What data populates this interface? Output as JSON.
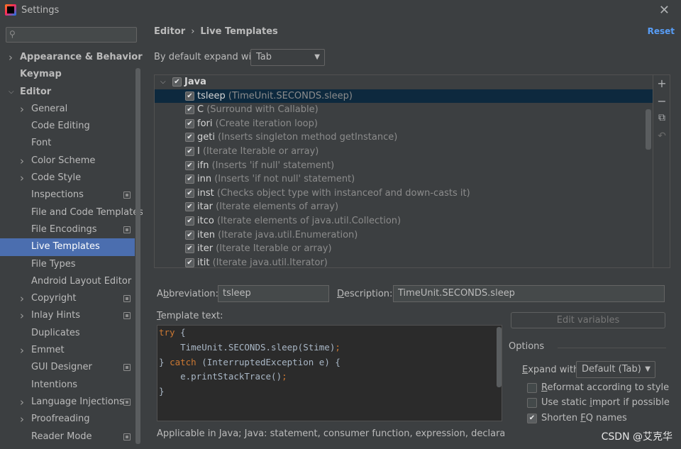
{
  "window": {
    "title": "Settings"
  },
  "search": {
    "placeholder": "",
    "value": ""
  },
  "sidebar": {
    "items": [
      {
        "label": "Appearance & Behavior",
        "level": 0,
        "arrow": "right",
        "bold": true,
        "project": false,
        "selected": false
      },
      {
        "label": "Keymap",
        "level": 0,
        "arrow": "",
        "bold": true,
        "project": false,
        "selected": false
      },
      {
        "label": "Editor",
        "level": 0,
        "arrow": "down",
        "bold": true,
        "project": false,
        "selected": false
      },
      {
        "label": "General",
        "level": 1,
        "arrow": "right",
        "bold": false,
        "project": false,
        "selected": false
      },
      {
        "label": "Code Editing",
        "level": 1,
        "arrow": "",
        "bold": false,
        "project": false,
        "selected": false
      },
      {
        "label": "Font",
        "level": 1,
        "arrow": "",
        "bold": false,
        "project": false,
        "selected": false
      },
      {
        "label": "Color Scheme",
        "level": 1,
        "arrow": "right",
        "bold": false,
        "project": false,
        "selected": false
      },
      {
        "label": "Code Style",
        "level": 1,
        "arrow": "right",
        "bold": false,
        "project": false,
        "selected": false
      },
      {
        "label": "Inspections",
        "level": 1,
        "arrow": "",
        "bold": false,
        "project": true,
        "selected": false
      },
      {
        "label": "File and Code Templates",
        "level": 1,
        "arrow": "",
        "bold": false,
        "project": false,
        "selected": false
      },
      {
        "label": "File Encodings",
        "level": 1,
        "arrow": "",
        "bold": false,
        "project": true,
        "selected": false
      },
      {
        "label": "Live Templates",
        "level": 1,
        "arrow": "",
        "bold": false,
        "project": false,
        "selected": true
      },
      {
        "label": "File Types",
        "level": 1,
        "arrow": "",
        "bold": false,
        "project": false,
        "selected": false
      },
      {
        "label": "Android Layout Editor",
        "level": 1,
        "arrow": "",
        "bold": false,
        "project": false,
        "selected": false
      },
      {
        "label": "Copyright",
        "level": 1,
        "arrow": "right",
        "bold": false,
        "project": true,
        "selected": false
      },
      {
        "label": "Inlay Hints",
        "level": 1,
        "arrow": "right",
        "bold": false,
        "project": true,
        "selected": false
      },
      {
        "label": "Duplicates",
        "level": 1,
        "arrow": "",
        "bold": false,
        "project": false,
        "selected": false
      },
      {
        "label": "Emmet",
        "level": 1,
        "arrow": "right",
        "bold": false,
        "project": false,
        "selected": false
      },
      {
        "label": "GUI Designer",
        "level": 1,
        "arrow": "",
        "bold": false,
        "project": true,
        "selected": false
      },
      {
        "label": "Intentions",
        "level": 1,
        "arrow": "",
        "bold": false,
        "project": false,
        "selected": false
      },
      {
        "label": "Language Injections",
        "level": 1,
        "arrow": "right",
        "bold": false,
        "project": true,
        "selected": false
      },
      {
        "label": "Proofreading",
        "level": 1,
        "arrow": "right",
        "bold": false,
        "project": false,
        "selected": false
      },
      {
        "label": "Reader Mode",
        "level": 1,
        "arrow": "",
        "bold": false,
        "project": true,
        "selected": false
      }
    ]
  },
  "header": {
    "crumb_parent": "Editor",
    "crumb_sep": "›",
    "crumb_current": "Live Templates",
    "reset": "Reset"
  },
  "expand": {
    "label": "By default expand with",
    "value": "Tab"
  },
  "templates": {
    "group": "Java",
    "items": [
      {
        "abbr": "tsleep",
        "desc": "(TimeUnit.SECONDS.sleep)",
        "checked": true,
        "selected": true
      },
      {
        "abbr": "C",
        "desc": "(Surround with Callable)",
        "checked": true,
        "selected": false
      },
      {
        "abbr": "fori",
        "desc": "(Create iteration loop)",
        "checked": true,
        "selected": false
      },
      {
        "abbr": "geti",
        "desc": "(Inserts singleton method getInstance)",
        "checked": true,
        "selected": false
      },
      {
        "abbr": "I",
        "desc": "(Iterate Iterable or array)",
        "checked": true,
        "selected": false
      },
      {
        "abbr": "ifn",
        "desc": "(Inserts 'if null' statement)",
        "checked": true,
        "selected": false
      },
      {
        "abbr": "inn",
        "desc": "(Inserts 'if not null' statement)",
        "checked": true,
        "selected": false
      },
      {
        "abbr": "inst",
        "desc": "(Checks object type with instanceof and down-casts it)",
        "checked": true,
        "selected": false
      },
      {
        "abbr": "itar",
        "desc": "(Iterate elements of array)",
        "checked": true,
        "selected": false
      },
      {
        "abbr": "itco",
        "desc": "(Iterate elements of java.util.Collection)",
        "checked": true,
        "selected": false
      },
      {
        "abbr": "iten",
        "desc": "(Iterate java.util.Enumeration)",
        "checked": true,
        "selected": false
      },
      {
        "abbr": "iter",
        "desc": "(Iterate Iterable or array)",
        "checked": true,
        "selected": false
      },
      {
        "abbr": "itit",
        "desc": "(Iterate java.util.Iterator)",
        "checked": true,
        "selected": false
      }
    ]
  },
  "tools": {
    "add": "+",
    "remove": "−",
    "copy": "⧉",
    "revert": "↶"
  },
  "details": {
    "abbr_label_pre": "A",
    "abbr_label_u": "b",
    "abbr_label_post": "breviation:",
    "abbr_value": "tsleep",
    "desc_label_u": "D",
    "desc_label_post": "escription:",
    "desc_value": "TimeUnit.SECONDS.sleep",
    "template_label_u": "T",
    "template_label_post": "emplate text:"
  },
  "code": {
    "line1_kw": "try",
    "line1_rest": " {",
    "line2": "    TimeUnit.SECONDS.sleep(Stime)",
    "line2_semi": ";",
    "line3_a": "} ",
    "line3_kw": "catch",
    "line3_rest": " (InterruptedException e) {",
    "line4": "    e.printStackTrace()",
    "line4_semi": ";",
    "line5": "}"
  },
  "options": {
    "edit_variables": "Edit variables",
    "title": "Options",
    "expand_label_u": "E",
    "expand_label_post": "xpand with",
    "expand_value": "Default (Tab)",
    "reformat_u": "R",
    "reformat_post": "eformat according to style",
    "reformat_checked": false,
    "static_pre": "Use static ",
    "static_u": "i",
    "static_post": "mport if possible",
    "static_checked": false,
    "shorten_pre": "Shorten ",
    "shorten_u": "F",
    "shorten_post": "Q names",
    "shorten_checked": true
  },
  "applicable": "Applicable in Java; Java: statement, consumer function, expression, declaration, comm",
  "watermark": "CSDN @艾克华"
}
